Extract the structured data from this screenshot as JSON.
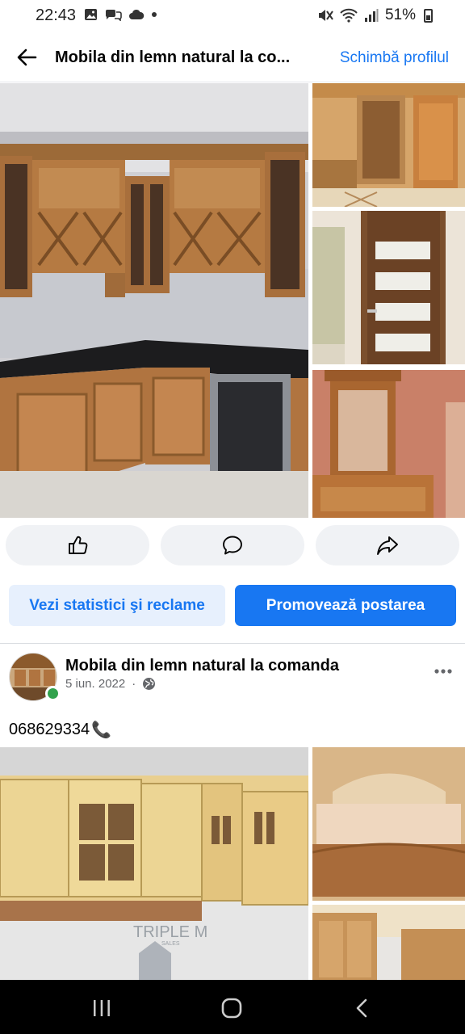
{
  "status_bar": {
    "time": "22:43",
    "battery": "51%",
    "icons": [
      "gallery-icon",
      "chat-icon",
      "cloud-icon",
      "dot-icon",
      "mute-icon",
      "wifi-icon",
      "signal-icon",
      "battery-icon"
    ]
  },
  "header": {
    "title": "Mobila din lemn natural la co...",
    "change_profile": "Schimbă profilul"
  },
  "actions": {
    "like": "thumbs-up-icon",
    "comment": "comment-icon",
    "share": "share-icon"
  },
  "promo": {
    "stats_label": "Vezi statistici şi reclame",
    "promote_label": "Promovează postarea"
  },
  "post": {
    "author": "Mobila din lemn natural la comanda",
    "date": "5 iun. 2022",
    "separator": "·",
    "text": "068629334",
    "phone_emoji": "📞",
    "watermark_main": "TRIPLE M",
    "watermark_sub": "SALES"
  },
  "colors": {
    "accent": "#1877f2",
    "light_accent": "#e7f0fd",
    "button_gray": "#f0f2f5",
    "online": "#31a24c"
  },
  "navbar": {
    "icons": [
      "recent-apps-icon",
      "home-icon",
      "back-nav-icon"
    ]
  }
}
